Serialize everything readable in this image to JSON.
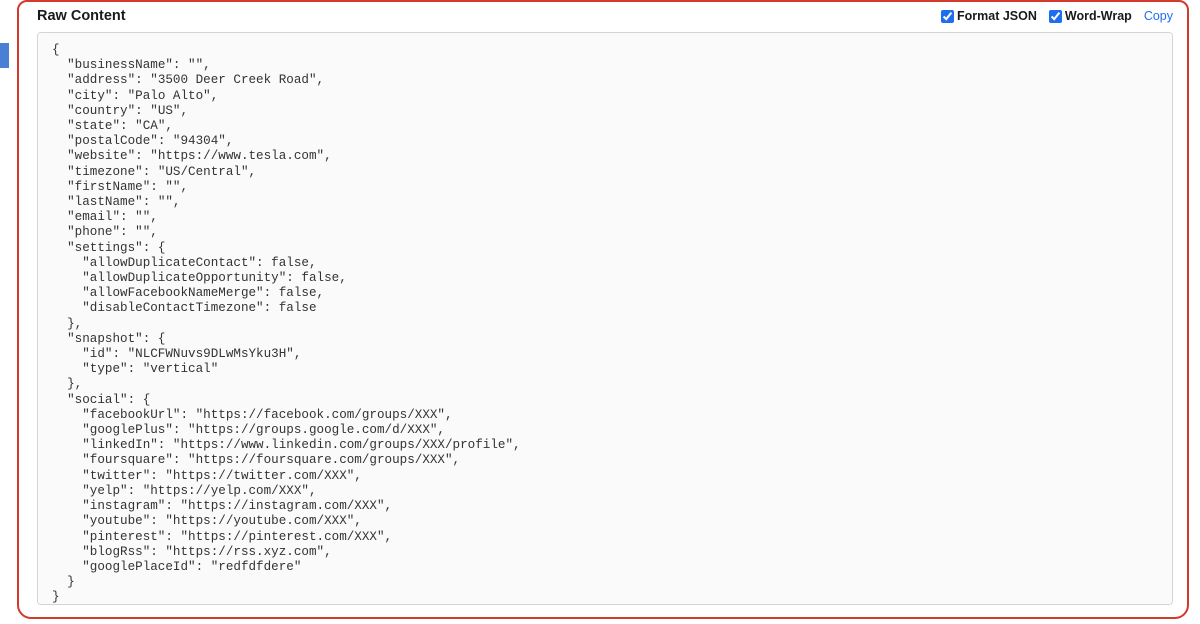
{
  "header": {
    "title": "Raw Content",
    "formatJsonLabel": "Format JSON",
    "formatJsonChecked": true,
    "wordWrapLabel": "Word-Wrap",
    "wordWrapChecked": true,
    "copyLabel": "Copy"
  },
  "content": "{\n  \"businessName\": \"\",\n  \"address\": \"3500 Deer Creek Road\",\n  \"city\": \"Palo Alto\",\n  \"country\": \"US\",\n  \"state\": \"CA\",\n  \"postalCode\": \"94304\",\n  \"website\": \"https://www.tesla.com\",\n  \"timezone\": \"US/Central\",\n  \"firstName\": \"\",\n  \"lastName\": \"\",\n  \"email\": \"\",\n  \"phone\": \"\",\n  \"settings\": {\n    \"allowDuplicateContact\": false,\n    \"allowDuplicateOpportunity\": false,\n    \"allowFacebookNameMerge\": false,\n    \"disableContactTimezone\": false\n  },\n  \"snapshot\": {\n    \"id\": \"NLCFWNuvs9DLwMsYku3H\",\n    \"type\": \"vertical\"\n  },\n  \"social\": {\n    \"facebookUrl\": \"https://facebook.com/groups/XXX\",\n    \"googlePlus\": \"https://groups.google.com/d/XXX\",\n    \"linkedIn\": \"https://www.linkedin.com/groups/XXX/profile\",\n    \"foursquare\": \"https://foursquare.com/groups/XXX\",\n    \"twitter\": \"https://twitter.com/XXX\",\n    \"yelp\": \"https://yelp.com/XXX\",\n    \"instagram\": \"https://instagram.com/XXX\",\n    \"youtube\": \"https://youtube.com/XXX\",\n    \"pinterest\": \"https://pinterest.com/XXX\",\n    \"blogRss\": \"https://rss.xyz.com\",\n    \"googlePlaceId\": \"redfdfdere\"\n  }\n}"
}
